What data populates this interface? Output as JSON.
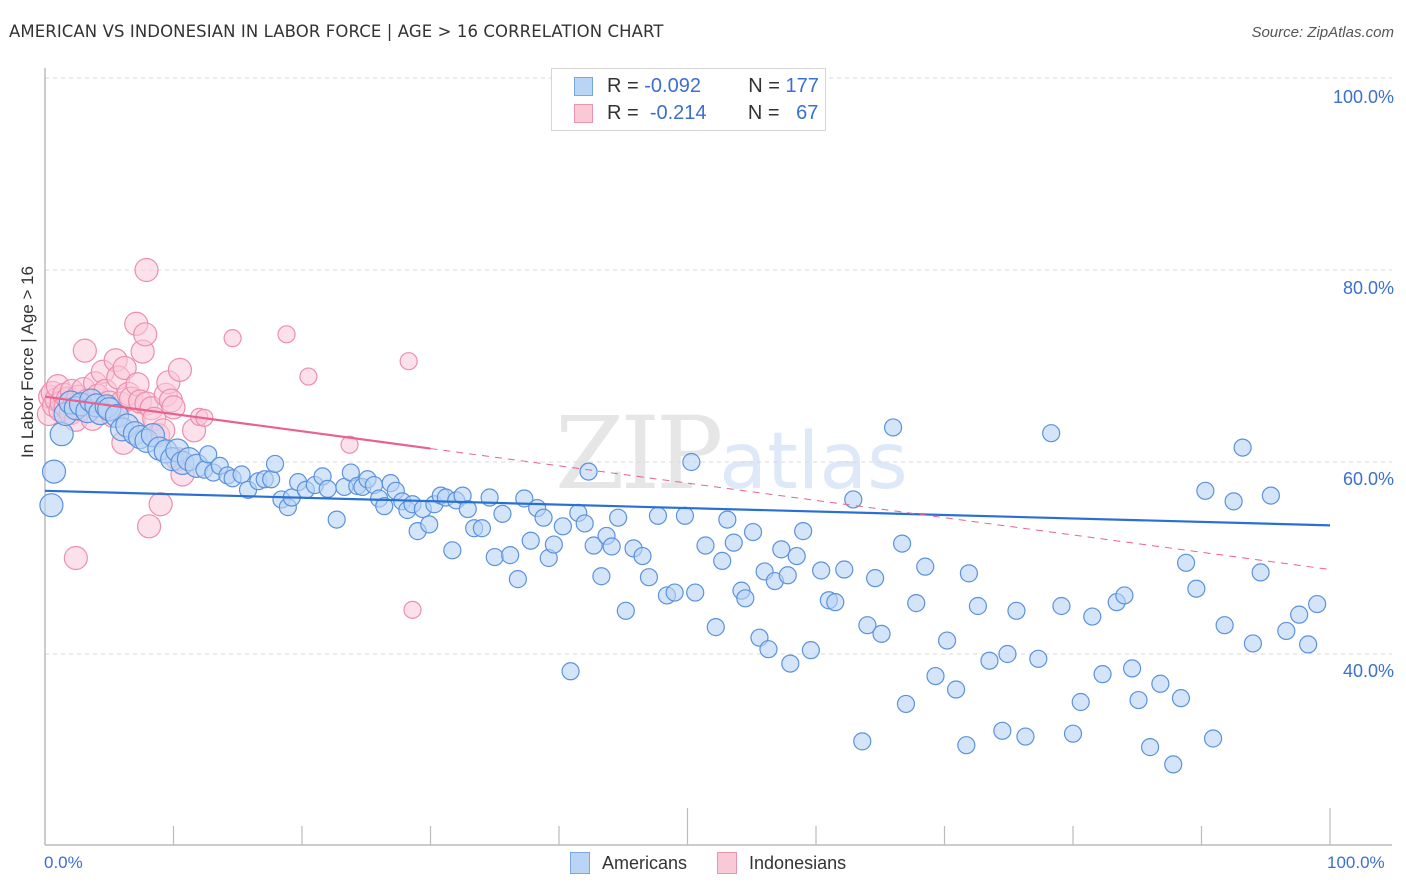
{
  "header": {
    "title": "AMERICAN VS INDONESIAN IN LABOR FORCE | AGE > 16 CORRELATION CHART",
    "source": "Source: ZipAtlas.com"
  },
  "watermark": {
    "zip": "ZIP",
    "atlas": "atlas"
  },
  "legend": {
    "rows": [
      {
        "r_label": "R =",
        "r_value": "-0.092",
        "n_label": "N =",
        "n_value": "177"
      },
      {
        "r_label": "R =",
        "r_value": "-0.214",
        "n_label": "N =",
        "n_value": "67"
      }
    ]
  },
  "colors": {
    "americans_fill": "#b9d4f5",
    "americans_stroke": "#5b92dd",
    "americans_line": "#2a6fd4",
    "indonesians_fill": "#f9c9d8",
    "indonesians_stroke": "#ec8fae",
    "indonesians_line": "#e8628f",
    "axis_label": "#3b6fd0",
    "grid": "#d9d9d9"
  },
  "chart_data": {
    "type": "scatter",
    "title": "AMERICAN VS INDONESIAN IN LABOR FORCE | AGE > 16 CORRELATION CHART",
    "xlabel": "",
    "ylabel": "In Labor Force | Age > 16",
    "xlim": [
      0,
      100
    ],
    "ylim": [
      20.1,
      102
    ],
    "x_tick_labels": [
      "0.0%",
      "100.0%"
    ],
    "y_ticks": [
      40,
      60,
      80,
      100
    ],
    "y_tick_labels": [
      "40.0%",
      "60.0%",
      "80.0%",
      "100.0%"
    ],
    "grid": true,
    "legend_position": "bottom-center",
    "series": [
      {
        "name": "Americans",
        "R": -0.092,
        "N": 177,
        "trend": {
          "x": [
            0,
            100
          ],
          "y": [
            57.0,
            53.4
          ],
          "solid_until": 100
        },
        "points": [
          [
            0.5,
            55.5
          ],
          [
            0.7,
            59.0
          ],
          [
            1.3,
            62.9
          ],
          [
            1.6,
            65.0
          ],
          [
            2.0,
            66.2
          ],
          [
            2.4,
            65.6
          ],
          [
            2.8,
            66.0
          ],
          [
            3.3,
            65.3
          ],
          [
            3.6,
            66.4
          ],
          [
            4.0,
            65.9
          ],
          [
            4.3,
            65.1
          ],
          [
            4.8,
            65.8
          ],
          [
            5.0,
            65.5
          ],
          [
            5.6,
            64.8
          ],
          [
            6.0,
            63.4
          ],
          [
            6.4,
            63.8
          ],
          [
            7.0,
            63.0
          ],
          [
            7.4,
            62.6
          ],
          [
            7.9,
            62.2
          ],
          [
            8.4,
            62.8
          ],
          [
            8.9,
            61.4
          ],
          [
            9.4,
            61.1
          ],
          [
            9.9,
            60.3
          ],
          [
            10.3,
            61.2
          ],
          [
            10.7,
            59.9
          ],
          [
            11.2,
            60.3
          ],
          [
            11.8,
            59.6
          ],
          [
            12.4,
            59.2
          ],
          [
            12.7,
            60.8
          ],
          [
            13.1,
            58.9
          ],
          [
            13.6,
            59.6
          ],
          [
            14.2,
            58.6
          ],
          [
            14.6,
            58.3
          ],
          [
            15.3,
            58.7
          ],
          [
            15.8,
            57.1
          ],
          [
            16.6,
            58.0
          ],
          [
            17.1,
            58.2
          ],
          [
            17.6,
            58.2
          ],
          [
            17.9,
            59.8
          ],
          [
            18.4,
            56.1
          ],
          [
            18.9,
            55.3
          ],
          [
            19.2,
            56.3
          ],
          [
            19.7,
            57.9
          ],
          [
            20.3,
            57.1
          ],
          [
            21.0,
            57.6
          ],
          [
            21.6,
            58.5
          ],
          [
            22.0,
            57.2
          ],
          [
            22.7,
            54.0
          ],
          [
            23.3,
            57.4
          ],
          [
            23.8,
            58.9
          ],
          [
            24.3,
            57.5
          ],
          [
            24.7,
            57.4
          ],
          [
            25.1,
            58.2
          ],
          [
            25.6,
            57.6
          ],
          [
            26.0,
            56.2
          ],
          [
            26.4,
            55.4
          ],
          [
            26.9,
            57.8
          ],
          [
            27.3,
            57.0
          ],
          [
            27.8,
            55.9
          ],
          [
            28.2,
            55.0
          ],
          [
            28.6,
            55.6
          ],
          [
            29.0,
            52.8
          ],
          [
            29.4,
            55.1
          ],
          [
            29.9,
            53.5
          ],
          [
            30.3,
            55.6
          ],
          [
            30.8,
            56.5
          ],
          [
            31.2,
            56.3
          ],
          [
            31.7,
            50.8
          ],
          [
            32.0,
            56.0
          ],
          [
            32.5,
            56.5
          ],
          [
            32.9,
            55.1
          ],
          [
            33.4,
            53.1
          ],
          [
            34.0,
            53.1
          ],
          [
            34.6,
            56.3
          ],
          [
            35.0,
            50.1
          ],
          [
            35.6,
            54.6
          ],
          [
            36.2,
            50.3
          ],
          [
            36.8,
            47.8
          ],
          [
            37.3,
            56.2
          ],
          [
            37.8,
            51.8
          ],
          [
            38.3,
            55.2
          ],
          [
            38.8,
            54.2
          ],
          [
            39.2,
            50.0
          ],
          [
            39.6,
            51.4
          ],
          [
            40.3,
            53.3
          ],
          [
            40.9,
            38.2
          ],
          [
            41.5,
            54.7
          ],
          [
            42.0,
            53.6
          ],
          [
            42.3,
            59.0
          ],
          [
            42.7,
            51.3
          ],
          [
            43.3,
            48.1
          ],
          [
            43.7,
            52.3
          ],
          [
            44.1,
            51.2
          ],
          [
            44.6,
            54.2
          ],
          [
            45.2,
            44.5
          ],
          [
            45.8,
            51.0
          ],
          [
            46.5,
            50.2
          ],
          [
            47.0,
            48.0
          ],
          [
            47.7,
            54.4
          ],
          [
            48.4,
            46.1
          ],
          [
            49.0,
            46.4
          ],
          [
            49.8,
            54.4
          ],
          [
            50.3,
            60.0
          ],
          [
            50.6,
            46.4
          ],
          [
            51.4,
            51.3
          ],
          [
            52.2,
            42.8
          ],
          [
            52.7,
            49.7
          ],
          [
            53.1,
            54.0
          ],
          [
            53.6,
            51.6
          ],
          [
            54.2,
            46.6
          ],
          [
            54.5,
            45.8
          ],
          [
            55.1,
            52.7
          ],
          [
            55.6,
            41.7
          ],
          [
            56.0,
            48.6
          ],
          [
            56.3,
            40.5
          ],
          [
            56.8,
            47.6
          ],
          [
            57.3,
            50.9
          ],
          [
            57.8,
            48.2
          ],
          [
            58.0,
            39.0
          ],
          [
            58.5,
            50.2
          ],
          [
            59.0,
            52.8
          ],
          [
            59.6,
            40.4
          ],
          [
            60.4,
            48.7
          ],
          [
            61.0,
            45.6
          ],
          [
            61.5,
            45.4
          ],
          [
            62.2,
            48.8
          ],
          [
            62.9,
            56.1
          ],
          [
            63.6,
            30.9
          ],
          [
            64.0,
            43.0
          ],
          [
            64.6,
            47.9
          ],
          [
            65.1,
            42.1
          ],
          [
            66.0,
            63.6
          ],
          [
            66.7,
            51.5
          ],
          [
            67.0,
            34.8
          ],
          [
            67.8,
            45.3
          ],
          [
            68.5,
            49.1
          ],
          [
            69.3,
            37.7
          ],
          [
            70.2,
            41.4
          ],
          [
            70.9,
            36.3
          ],
          [
            71.7,
            30.5
          ],
          [
            71.9,
            48.4
          ],
          [
            72.6,
            45.0
          ],
          [
            73.5,
            39.3
          ],
          [
            74.5,
            32.0
          ],
          [
            74.9,
            40.0
          ],
          [
            75.6,
            44.5
          ],
          [
            76.3,
            31.4
          ],
          [
            77.3,
            39.5
          ],
          [
            78.3,
            63.0
          ],
          [
            79.1,
            45.0
          ],
          [
            80.0,
            31.7
          ],
          [
            80.6,
            35.0
          ],
          [
            81.5,
            43.9
          ],
          [
            82.3,
            37.9
          ],
          [
            83.4,
            45.4
          ],
          [
            84.0,
            46.1
          ],
          [
            84.6,
            38.5
          ],
          [
            85.1,
            35.2
          ],
          [
            86.0,
            30.3
          ],
          [
            86.8,
            36.9
          ],
          [
            87.8,
            28.5
          ],
          [
            88.4,
            35.4
          ],
          [
            88.8,
            49.5
          ],
          [
            89.6,
            46.8
          ],
          [
            90.3,
            57.0
          ],
          [
            90.9,
            31.2
          ],
          [
            91.8,
            43.0
          ],
          [
            92.5,
            55.9
          ],
          [
            93.2,
            61.5
          ],
          [
            94.0,
            41.1
          ],
          [
            94.6,
            48.5
          ],
          [
            95.4,
            56.5
          ],
          [
            96.6,
            42.4
          ],
          [
            97.6,
            44.1
          ],
          [
            98.3,
            41.0
          ],
          [
            99.0,
            45.2
          ]
        ]
      },
      {
        "name": "Indonesians",
        "R": -0.214,
        "N": 67,
        "trend": {
          "x": [
            0,
            100
          ],
          "y": [
            66.8,
            48.8
          ],
          "solid_until": 30
        },
        "points": [
          [
            0.3,
            65.0
          ],
          [
            0.4,
            66.8
          ],
          [
            0.6,
            67.2
          ],
          [
            0.7,
            65.9
          ],
          [
            0.9,
            66.5
          ],
          [
            1.0,
            67.9
          ],
          [
            1.2,
            65.4
          ],
          [
            1.3,
            66.2
          ],
          [
            1.5,
            67.0
          ],
          [
            1.6,
            65.8
          ],
          [
            1.8,
            66.6
          ],
          [
            2.0,
            65.1
          ],
          [
            2.1,
            67.4
          ],
          [
            2.3,
            66.0
          ],
          [
            2.4,
            64.4
          ],
          [
            2.6,
            66.8
          ],
          [
            2.8,
            65.5
          ],
          [
            3.0,
            67.6
          ],
          [
            3.1,
            71.6
          ],
          [
            3.3,
            66.4
          ],
          [
            3.5,
            65.9
          ],
          [
            3.7,
            64.5
          ],
          [
            3.9,
            68.2
          ],
          [
            4.1,
            66.9
          ],
          [
            4.3,
            65.1
          ],
          [
            4.5,
            69.4
          ],
          [
            4.7,
            67.4
          ],
          [
            4.9,
            65.6
          ],
          [
            5.0,
            66.2
          ],
          [
            5.3,
            64.8
          ],
          [
            5.5,
            70.6
          ],
          [
            5.7,
            68.8
          ],
          [
            5.9,
            66.1
          ],
          [
            6.1,
            62.0
          ],
          [
            6.2,
            69.8
          ],
          [
            6.5,
            67.1
          ],
          [
            6.7,
            66.6
          ],
          [
            6.9,
            64.3
          ],
          [
            7.1,
            74.4
          ],
          [
            7.2,
            68.1
          ],
          [
            7.4,
            66.3
          ],
          [
            7.6,
            71.5
          ],
          [
            7.8,
            73.3
          ],
          [
            7.9,
            66.1
          ],
          [
            8.1,
            53.3
          ],
          [
            8.3,
            65.6
          ],
          [
            8.5,
            64.5
          ],
          [
            8.8,
            62.8
          ],
          [
            9.0,
            55.6
          ],
          [
            9.2,
            63.3
          ],
          [
            9.4,
            67.0
          ],
          [
            9.6,
            68.3
          ],
          [
            9.8,
            66.4
          ],
          [
            10.0,
            65.7
          ],
          [
            10.3,
            60.3
          ],
          [
            10.5,
            69.6
          ],
          [
            10.7,
            58.7
          ],
          [
            11.6,
            63.3
          ],
          [
            12.0,
            64.7
          ],
          [
            12.4,
            64.6
          ],
          [
            2.4,
            50.0
          ],
          [
            7.9,
            80.0
          ],
          [
            14.6,
            72.9
          ],
          [
            18.8,
            73.3
          ],
          [
            20.5,
            68.9
          ],
          [
            23.7,
            61.8
          ],
          [
            28.3,
            70.5
          ],
          [
            28.6,
            44.6
          ]
        ]
      }
    ]
  }
}
